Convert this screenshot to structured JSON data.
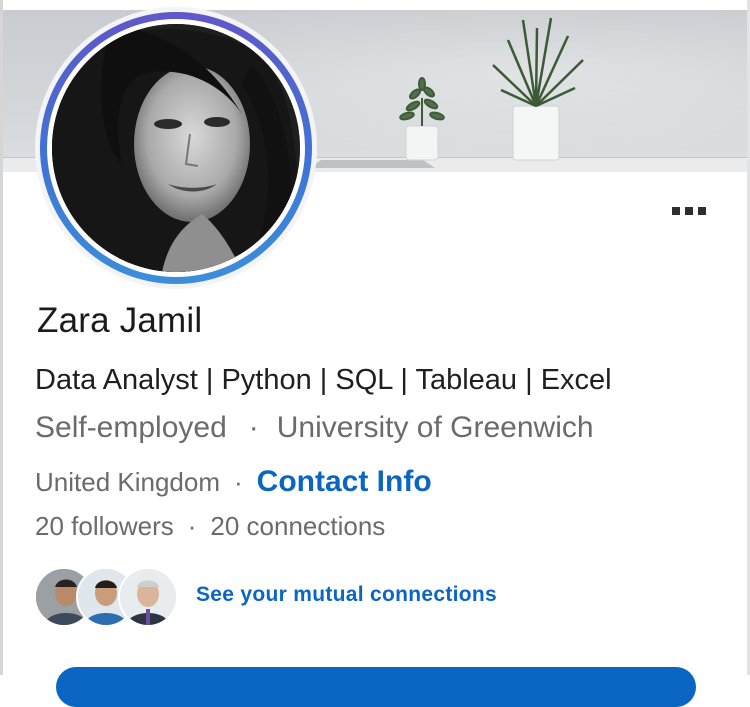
{
  "profile": {
    "name": "Zara Jamil",
    "headline": "Data Analyst | Python | SQL | Tableau | Excel",
    "employment": "Self-employed",
    "education": "University of Greenwich",
    "location": "United Kingdom",
    "contact_info_label": "Contact Info",
    "followers": "20 followers",
    "connections": "20 connections",
    "separator": "·"
  },
  "mutual": {
    "link_label": "See your mutual connections"
  },
  "icons": {
    "more": "more-options-icon"
  },
  "colors": {
    "accent": "#0a66c2",
    "ring_top": "#5f57c9",
    "ring_bottom": "#3b8fdb",
    "muted_text": "#6b6b6b"
  }
}
